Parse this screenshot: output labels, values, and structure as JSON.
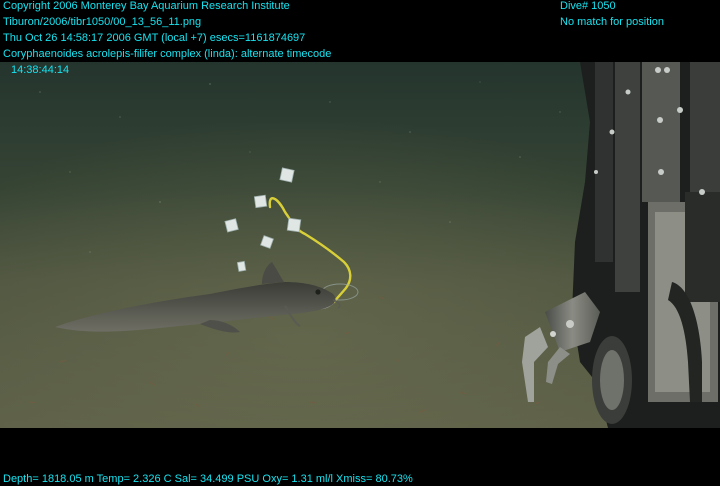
{
  "overlay": {
    "copyright": "Copyright 2006 Monterey Bay Aquarium Research Institute",
    "file_path": "Tiburon/2006/tibr1050/00_13_56_11.png",
    "date_line": "Thu Oct 26 14:58:17 2006 GMT (local +7)  esecs=1161874697",
    "annotation": "Coryphaenoides acrolepis-filifer complex (linda): alternate timecode",
    "timecode": "14:38:44:14",
    "dive": "Dive# 1050",
    "position_status": "No match for position",
    "sensor_line": "Depth= 1818.05 m  Temp= 2.326 C  Sal= 34.499 PSU  Oxy= 1.31 ml/l  Xmiss= 80.73%"
  },
  "colors": {
    "overlay_text": "#17e3f0",
    "seafloor": "#5b5f45",
    "water": "#27382f"
  }
}
